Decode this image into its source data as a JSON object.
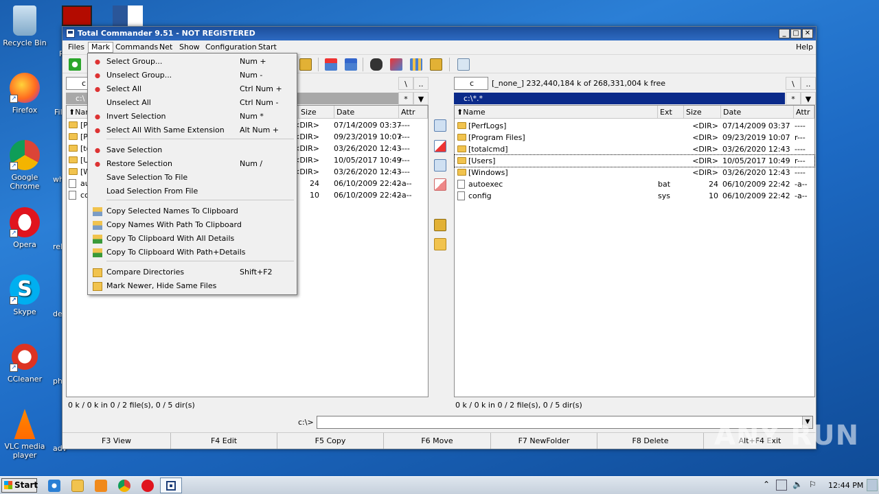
{
  "desktop": {
    "icons": [
      {
        "label": "Recycle Bin"
      },
      {
        "label": "Firefox"
      },
      {
        "label": "Google Chrome"
      },
      {
        "label": "Opera"
      },
      {
        "label": "Skype"
      },
      {
        "label": "CCleaner"
      },
      {
        "label": "VLC media player"
      }
    ],
    "cut_labels": [
      "Fil",
      "wh",
      "rel",
      "dev",
      "pho",
      "adv",
      "R"
    ]
  },
  "window": {
    "title": "Total Commander 9.51 - NOT REGISTERED",
    "menu": [
      "Files",
      "Mark",
      "Commands",
      "Net",
      "Show",
      "Configuration",
      "Start",
      "Help"
    ]
  },
  "left_panel": {
    "drive": "c",
    "path": "c:\\",
    "headers": {
      "size": "Size",
      "date": "Date",
      "attr": "Attr",
      "name": "Nam"
    },
    "rows": [
      {
        "name": "[P",
        "size": "<DIR>",
        "date": "07/14/2009 03:37",
        "attr": "----"
      },
      {
        "name": "[P",
        "size": "<DIR>",
        "date": "09/23/2019 10:07",
        "attr": "r---"
      },
      {
        "name": "[to",
        "size": "<DIR>",
        "date": "03/26/2020 12:43",
        "attr": "----"
      },
      {
        "name": "[U",
        "size": "<DIR>",
        "date": "10/05/2017 10:49",
        "attr": "r---"
      },
      {
        "name": "[W",
        "size": "<DIR>",
        "date": "03/26/2020 12:43",
        "attr": "----"
      },
      {
        "name": "au",
        "size": "24",
        "date": "06/10/2009 22:42",
        "attr": "-a--"
      },
      {
        "name": "cc",
        "size": "10",
        "date": "06/10/2009 22:42",
        "attr": "-a--"
      }
    ],
    "status": "0 k / 0 k in 0 / 2 file(s), 0 / 5 dir(s)",
    "backslash": "\\",
    "dotdot": "..",
    "star": "*"
  },
  "right_panel": {
    "drive": "c",
    "drive_info": "[_none_]  232,440,184 k of 268,331,004 k free",
    "path": "c:\\*.*",
    "headers": {
      "name": "Name",
      "ext": "Ext",
      "size": "Size",
      "date": "Date",
      "attr": "Attr"
    },
    "rows": [
      {
        "name": "[PerfLogs]",
        "ext": "",
        "size": "<DIR>",
        "date": "07/14/2009 03:37",
        "attr": "----",
        "type": "dir"
      },
      {
        "name": "[Program Files]",
        "ext": "",
        "size": "<DIR>",
        "date": "09/23/2019 10:07",
        "attr": "r---",
        "type": "dir"
      },
      {
        "name": "[totalcmd]",
        "ext": "",
        "size": "<DIR>",
        "date": "03/26/2020 12:43",
        "attr": "----",
        "type": "dir"
      },
      {
        "name": "[Users]",
        "ext": "",
        "size": "<DIR>",
        "date": "10/05/2017 10:49",
        "attr": "r---",
        "type": "dir"
      },
      {
        "name": "[Windows]",
        "ext": "",
        "size": "<DIR>",
        "date": "03/26/2020 12:43",
        "attr": "----",
        "type": "dir"
      },
      {
        "name": "autoexec",
        "ext": "bat",
        "size": "24",
        "date": "06/10/2009 22:42",
        "attr": "-a--",
        "type": "file"
      },
      {
        "name": "config",
        "ext": "sys",
        "size": "10",
        "date": "06/10/2009 22:42",
        "attr": "-a--",
        "type": "file"
      }
    ],
    "status": "0 k / 0 k in 0 / 2 file(s), 0 / 5 dir(s)",
    "backslash": "\\",
    "dotdot": "..",
    "star": "*"
  },
  "command_line": {
    "prompt": "c:\\>",
    "value": ""
  },
  "fkeys": [
    "F3 View",
    "F4 Edit",
    "F5 Copy",
    "F6 Move",
    "F7 NewFolder",
    "F8 Delete",
    "Alt+F4 Exit"
  ],
  "mark_menu": {
    "items": [
      {
        "label": "Select Group...",
        "key": "Num +"
      },
      {
        "label": "Unselect Group...",
        "key": "Num -"
      },
      {
        "label": "Select All",
        "key": "Ctrl Num +"
      },
      {
        "label": "Unselect All",
        "key": "Ctrl Num -"
      },
      {
        "label": "Invert Selection",
        "key": "Num *"
      },
      {
        "label": "Select All With Same Extension",
        "key": "Alt Num +"
      },
      {
        "label": "Save Selection",
        "key": ""
      },
      {
        "label": "Restore Selection",
        "key": "Num /"
      },
      {
        "label": "Save Selection To File",
        "key": ""
      },
      {
        "label": "Load Selection From File",
        "key": ""
      },
      {
        "label": "Copy Selected Names To Clipboard",
        "key": ""
      },
      {
        "label": "Copy Names With Path To Clipboard",
        "key": ""
      },
      {
        "label": "Copy To Clipboard With All Details",
        "key": ""
      },
      {
        "label": "Copy To Clipboard With Path+Details",
        "key": ""
      },
      {
        "label": "Compare Directories",
        "key": "Shift+F2"
      },
      {
        "label": "Mark Newer, Hide Same Files",
        "key": ""
      }
    ]
  },
  "taskbar": {
    "start": "Start",
    "time": "12:44 PM"
  },
  "watermark": "ANY RUN"
}
